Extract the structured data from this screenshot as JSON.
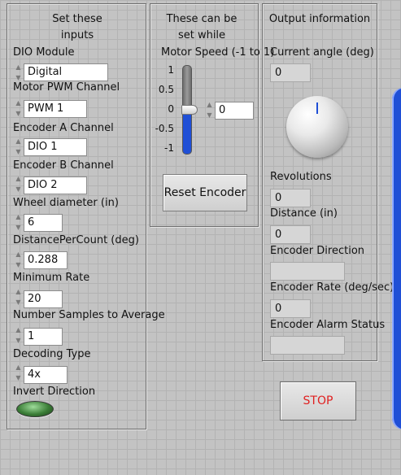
{
  "inputs_panel": {
    "title_line1": "Set these",
    "title_line2": "inputs",
    "dio_module": {
      "label": "DIO Module",
      "value": "Digital"
    },
    "motor_pwm_channel": {
      "label": "Motor PWM Channel",
      "value": "PWM 1"
    },
    "encoder_a_channel": {
      "label": "Encoder A Channel",
      "value": "DIO 1"
    },
    "encoder_b_channel": {
      "label": "Encoder B Channel",
      "value": "DIO 2"
    },
    "wheel_diameter": {
      "label": "Wheel diameter (in)",
      "value": "6"
    },
    "distance_per_count": {
      "label": "DistancePerCount (deg)",
      "value": "0.288"
    },
    "minimum_rate": {
      "label": "Minimum Rate",
      "value": "20"
    },
    "number_samples": {
      "label": "Number Samples to Average",
      "value": "1"
    },
    "decoding_type": {
      "label": "Decoding Type",
      "value": "4x"
    },
    "invert_direction": {
      "label": "Invert Direction",
      "state": "off"
    }
  },
  "runtime_panel": {
    "title_line1": "These can be",
    "title_line2": "set while",
    "motor_speed": {
      "label": "Motor Speed (-1 to 1)",
      "ticks": [
        "1",
        "0.5",
        "0",
        "-0.5",
        "-1"
      ],
      "value": "0",
      "level": 0,
      "fill_color": "#1f4fd6"
    },
    "reset_button": "Reset Encoder"
  },
  "output_panel": {
    "title": "Output information",
    "current_angle": {
      "label": "Current angle (deg)",
      "value": "0"
    },
    "revolutions": {
      "label": "Revolutions",
      "value": "0"
    },
    "distance": {
      "label": "Distance (in)",
      "value": "0"
    },
    "encoder_direction": {
      "label": "Encoder Direction",
      "value": ""
    },
    "encoder_rate": {
      "label": "Encoder Rate (deg/sec)",
      "value": "0"
    },
    "encoder_alarm_status": {
      "label": "Encoder Alarm Status",
      "value": ""
    }
  },
  "stop_button": {
    "label": "STOP",
    "color": "#e02020"
  }
}
